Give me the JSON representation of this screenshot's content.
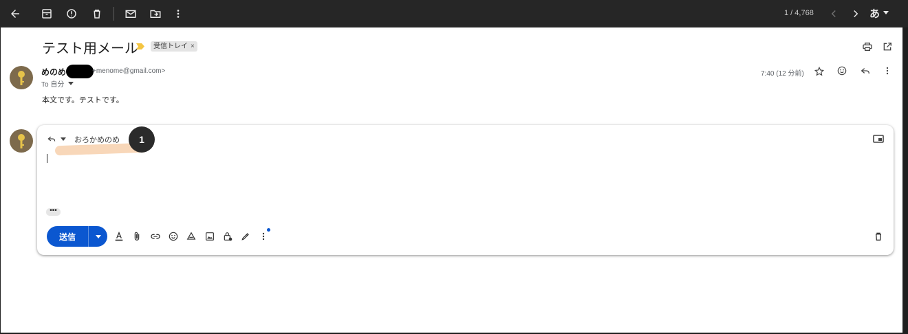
{
  "toolbar": {
    "pager": "1 / 4,768",
    "ime_label": "あ"
  },
  "email": {
    "subject": "テスト用メール",
    "label": "受信トレイ",
    "label_remove": "×",
    "sender_name": "めのめ",
    "sender_email": "+menome@gmail.com>",
    "to_line": "To 自分",
    "time": "7:40 (12 分前)",
    "body": "本文です。テストです。"
  },
  "compose": {
    "recipient": "おろかめのめ",
    "step_badge": "1",
    "ellipsis": "•••",
    "send_label": "送信"
  },
  "colors": {
    "send_button": "#0b57d0",
    "importance_marker": "#f4c542",
    "highlight": "#f5c9a2"
  }
}
